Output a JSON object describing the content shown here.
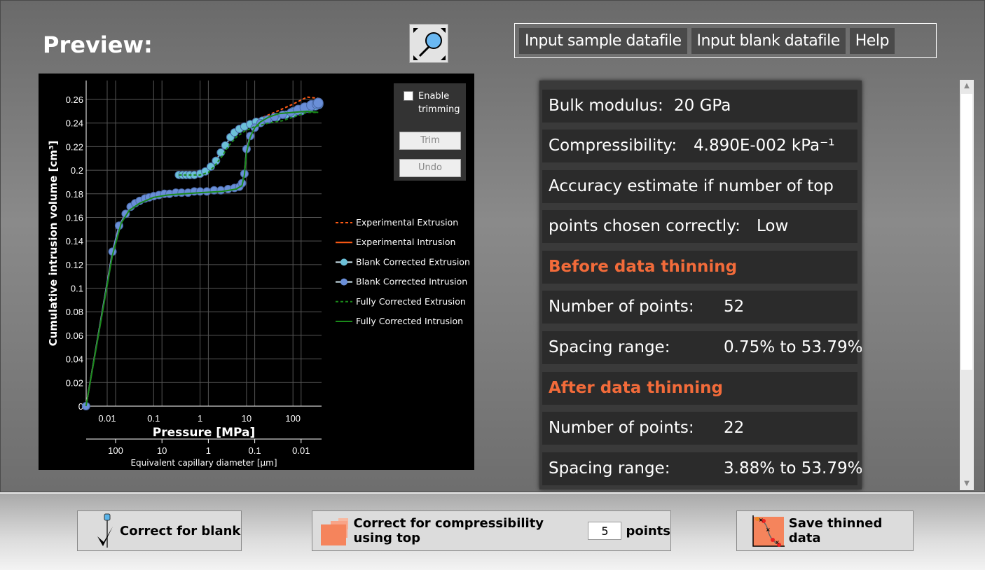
{
  "header": {
    "title": "Preview:",
    "menu": [
      "Input sample datafile",
      "Input blank datafile",
      "Help"
    ]
  },
  "trim": {
    "enable_label": "Enable trimming",
    "checked": false,
    "trim": "Trim",
    "undo": "Undo"
  },
  "info": {
    "bulk_label": "Bulk modulus:",
    "bulk_value": "20 GPa",
    "comp_label": "Compressibility:",
    "comp_value": "4.890E-002 kPa⁻¹",
    "acc_line1": "Accuracy estimate if number of top",
    "acc_line2": "points chosen correctly:",
    "acc_value": "Low",
    "before_heading": "Before data thinning",
    "before_points_label": "Number of points:",
    "before_points": "52",
    "before_spacing_label": "Spacing range:",
    "before_spacing": "0.75% to 53.79%",
    "after_heading": "After data thinning",
    "after_points_label": "Number of points:",
    "after_points": "22",
    "after_spacing_label": "Spacing range:",
    "after_spacing": "3.88% to 53.79%"
  },
  "buttons": {
    "blank": "Correct for blank",
    "comp_pre": "Correct for compressibility using top",
    "comp_value": "5",
    "comp_post": "points",
    "save": "Save thinned data"
  },
  "colors": {
    "accent": "#f26b3a",
    "intrusion": "#6a8fd8",
    "extrusion": "#6cc0d8",
    "experimental": "#ff5a14",
    "fully": "#1a8a1a"
  },
  "chart_data": {
    "type": "line",
    "xlabel": "Pressure [MPa]",
    "ylabel": "Cumulative intrusion volume [cm³]",
    "x2label": "Equivalent capillary diameter [µm]",
    "xscale": "log",
    "xlim": [
      0.0035,
      400
    ],
    "ylim": [
      0,
      0.275
    ],
    "xticks": [
      "0.01",
      "0.1",
      "1",
      "10",
      "100"
    ],
    "x2ticks": [
      "100",
      "10",
      "1",
      "0.1",
      "0.01"
    ],
    "yticks": [
      "0",
      "0.02",
      "0.04",
      "0.06",
      "0.08",
      "0.1",
      "0.12",
      "0.14",
      "0.16",
      "0.18",
      "0.2",
      "0.22",
      "0.24",
      "0.26"
    ],
    "grid": true,
    "legend": "right",
    "series": [
      {
        "name": "Experimental Extrusion",
        "style": "dashed",
        "color": "#ff5a14",
        "x": [
          0.35,
          1,
          2,
          3,
          5,
          8,
          12,
          20,
          40,
          100,
          200,
          350
        ],
        "y": [
          0.196,
          0.197,
          0.206,
          0.217,
          0.23,
          0.237,
          0.241,
          0.244,
          0.249,
          0.256,
          0.262,
          0.261
        ]
      },
      {
        "name": "Experimental Intrusion",
        "style": "solid",
        "color": "#ff5a14",
        "x": [
          0.0035,
          0.013,
          0.018,
          0.025,
          0.035,
          0.05,
          0.1,
          0.2,
          1,
          3,
          6,
          8,
          9,
          10,
          12,
          15,
          20,
          30,
          60,
          100,
          200,
          350
        ],
        "y": [
          0,
          0.131,
          0.153,
          0.163,
          0.169,
          0.173,
          0.177,
          0.179,
          0.181,
          0.183,
          0.185,
          0.189,
          0.197,
          0.218,
          0.229,
          0.236,
          0.24,
          0.243,
          0.247,
          0.25,
          0.254,
          0.257
        ]
      },
      {
        "name": "Blank Corrected Extrusion",
        "style": "markers",
        "color": "#6cc0d8",
        "x": [
          0.35,
          0.42,
          0.5,
          0.6,
          0.75,
          1,
          1.3,
          1.7,
          2.2,
          2.8,
          3.5,
          4.5,
          5.5,
          7,
          9,
          12,
          16,
          22,
          30,
          45,
          70,
          100,
          150,
          220,
          300,
          350
        ],
        "y": [
          0.196,
          0.196,
          0.196,
          0.196,
          0.196,
          0.197,
          0.199,
          0.203,
          0.208,
          0.215,
          0.221,
          0.228,
          0.232,
          0.235,
          0.237,
          0.239,
          0.241,
          0.242,
          0.243,
          0.245,
          0.247,
          0.249,
          0.251,
          0.253,
          0.255,
          0.256
        ]
      },
      {
        "name": "Blank Corrected Intrusion",
        "style": "markers",
        "color": "#6a8fd8",
        "x": [
          0.0035,
          0.013,
          0.018,
          0.025,
          0.032,
          0.04,
          0.05,
          0.065,
          0.08,
          0.1,
          0.13,
          0.17,
          0.22,
          0.3,
          0.4,
          0.55,
          0.75,
          1,
          1.4,
          2,
          2.8,
          4,
          5.5,
          7,
          8,
          9,
          10,
          12,
          15,
          20,
          28,
          40,
          60,
          90,
          130,
          180,
          250,
          330,
          350
        ],
        "y": [
          0,
          0.131,
          0.153,
          0.163,
          0.169,
          0.172,
          0.174,
          0.176,
          0.177,
          0.178,
          0.179,
          0.18,
          0.18,
          0.181,
          0.181,
          0.181,
          0.182,
          0.182,
          0.182,
          0.183,
          0.183,
          0.184,
          0.185,
          0.186,
          0.189,
          0.197,
          0.218,
          0.229,
          0.236,
          0.24,
          0.243,
          0.245,
          0.247,
          0.249,
          0.251,
          0.253,
          0.255,
          0.256,
          0.257
        ]
      },
      {
        "name": "Fully Corrected Extrusion",
        "style": "dashed",
        "color": "#1a8a1a",
        "x": [
          0.35,
          1,
          1.5,
          2,
          3,
          4,
          6,
          9,
          15,
          30,
          60,
          100,
          200,
          350
        ],
        "y": [
          0.196,
          0.196,
          0.198,
          0.203,
          0.212,
          0.22,
          0.228,
          0.233,
          0.237,
          0.24,
          0.242,
          0.245,
          0.249,
          0.249
        ]
      },
      {
        "name": "Fully Corrected Intrusion",
        "style": "solid",
        "color": "#1a8a1a",
        "x": [
          0.0035,
          0.013,
          0.02,
          0.03,
          0.05,
          0.1,
          0.2,
          1,
          3,
          6,
          8,
          9,
          10,
          12,
          15,
          20,
          30,
          50,
          100,
          200,
          350
        ],
        "y": [
          0,
          0.128,
          0.155,
          0.166,
          0.172,
          0.177,
          0.179,
          0.181,
          0.182,
          0.184,
          0.187,
          0.196,
          0.215,
          0.228,
          0.236,
          0.241,
          0.245,
          0.248,
          0.249,
          0.25,
          0.249
        ]
      }
    ]
  }
}
